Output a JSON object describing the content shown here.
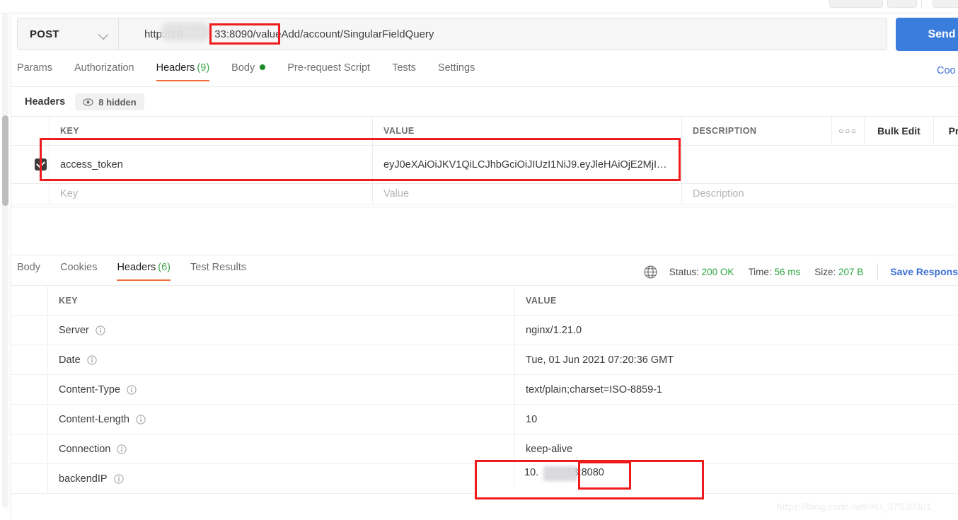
{
  "window": {
    "top_strip_visible": true
  },
  "request_bar": {
    "method": "POST",
    "method_caret_icon": "chevron-down-icon",
    "url": "http://10      33:8090/valueAdd/account/SingularFieldQuery",
    "url_redacted_note": "ip octets blurred",
    "send_label": "Send"
  },
  "request_tabs": [
    {
      "label": "Params",
      "count": "",
      "active": false,
      "dot": false
    },
    {
      "label": "Authorization",
      "count": "",
      "active": false,
      "dot": false
    },
    {
      "label": "Headers",
      "count": "(9)",
      "active": true,
      "dot": false
    },
    {
      "label": "Body",
      "count": "",
      "active": false,
      "dot": true
    },
    {
      "label": "Pre-request Script",
      "count": "",
      "active": false,
      "dot": false
    },
    {
      "label": "Tests",
      "count": "",
      "active": false,
      "dot": false
    },
    {
      "label": "Settings",
      "count": "",
      "active": false,
      "dot": false
    }
  ],
  "cookies_link": "Coo",
  "headers_section": {
    "title": "Headers",
    "hidden_pill": "8 hidden",
    "eye_icon": "eye-icon",
    "columns": {
      "key": "KEY",
      "value": "VALUE",
      "description": "DESCRIPTION"
    },
    "actions": {
      "dots_icon": "more-options-icon",
      "dots_glyph": "○○○",
      "bulk_edit": "Bulk Edit",
      "presets": "Preset"
    },
    "rows": [
      {
        "checked": true,
        "key": "access_token",
        "value": "eyJ0eXAiOiJKV1QiLCJhbGciOiJIUzI1NiJ9.eyJleHAiOjE2MjI…",
        "description": ""
      }
    ],
    "placeholder_row": {
      "key": "Key",
      "value": "Value",
      "description": "Description"
    }
  },
  "response_tabs": [
    {
      "label": "Body",
      "count": "",
      "active": false
    },
    {
      "label": "Cookies",
      "count": "",
      "active": false
    },
    {
      "label": "Headers",
      "count": "(6)",
      "active": true
    },
    {
      "label": "Test Results",
      "count": "",
      "active": false
    }
  ],
  "response_status": {
    "globe_icon": "globe-icon",
    "status_label": "Status:",
    "status_value": "200 OK",
    "time_label": "Time:",
    "time_value": "56 ms",
    "size_label": "Size:",
    "size_value": "207 B",
    "save_response": "Save Respons"
  },
  "response_headers": {
    "columns": {
      "key": "KEY",
      "value": "VALUE"
    },
    "info_icon": "info-icon",
    "rows": [
      {
        "key": "Server",
        "value": "nginx/1.21.0"
      },
      {
        "key": "Date",
        "value": "Tue, 01 Jun 2021 07:20:36 GMT"
      },
      {
        "key": "Content-Type",
        "value": "text/plain;charset=ISO-8859-1"
      },
      {
        "key": "Content-Length",
        "value": "10"
      },
      {
        "key": "Connection",
        "value": "keep-alive"
      },
      {
        "key": "backendIP",
        "value": "10.     .33:8080"
      }
    ]
  },
  "annotations": {
    "boxes": [
      {
        "name": "url-port-highlight",
        "target": "33:8090/value"
      },
      {
        "name": "request-header-highlight",
        "target": "access_token row"
      },
      {
        "name": "backendip-row-highlight",
        "target": "backendIP value cell"
      },
      {
        "name": "backendip-port-highlight",
        "target": "33:8080"
      }
    ],
    "color": "#ee1c1c"
  },
  "watermark": "https://blog.csdn.net/m0_37530301",
  "colors": {
    "accent_orange": "#f26b3a",
    "send_blue": "#3b7ddd",
    "link_blue": "#3b6fd4",
    "success_green": "#2aa53d",
    "annotation_red": "#ee1c1c"
  }
}
